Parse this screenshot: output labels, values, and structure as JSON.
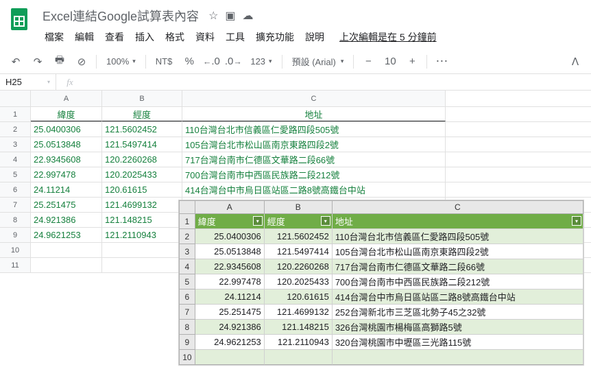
{
  "header": {
    "title": "Excel連結Google試算表內容"
  },
  "menu": {
    "file": "檔案",
    "edit": "編輯",
    "view": "查看",
    "insert": "插入",
    "format": "格式",
    "data": "資料",
    "tools": "工具",
    "ext": "擴充功能",
    "help": "說明",
    "last_edit": "上次編輯是在 5 分鐘前"
  },
  "toolbar": {
    "zoom": "100%",
    "currency": "NT$",
    "percent": "%",
    "dec0": ".0",
    "dec00": ".00",
    "numfmt": "123",
    "font": "預設 (Arial)",
    "size": "10"
  },
  "namebox": "H25",
  "sheet": {
    "cols": [
      "A",
      "B",
      "C"
    ],
    "header": {
      "lat": "緯度",
      "lng": "經度",
      "addr": "地址"
    },
    "rows": [
      {
        "lat": "25.0400306",
        "lng": "121.5602452",
        "addr": "110台灣台北市信義區仁愛路四段505號"
      },
      {
        "lat": "25.0513848",
        "lng": "121.5497414",
        "addr": "105台灣台北市松山區南京東路四段2號"
      },
      {
        "lat": "22.9345608",
        "lng": "120.2260268",
        "addr": "717台灣台南市仁德區文華路二段66號"
      },
      {
        "lat": "22.997478",
        "lng": "120.2025433",
        "addr": "700台灣台南市中西區民族路二段212號"
      },
      {
        "lat": "24.11214",
        "lng": "120.61615",
        "addr": "414台灣台中市烏日區站區二路8號高鐵台中站"
      },
      {
        "lat": "25.251475",
        "lng": "121.4699132",
        "addr": ""
      },
      {
        "lat": "24.921386",
        "lng": "121.148215",
        "addr": ""
      },
      {
        "lat": "24.9621253",
        "lng": "121.2110943",
        "addr": ""
      }
    ]
  },
  "overlay": {
    "cols": [
      "A",
      "B",
      "C"
    ],
    "header": {
      "lat": "緯度",
      "lng": "經度",
      "addr": "地址"
    },
    "rows": [
      {
        "lat": "25.0400306",
        "lng": "121.5602452",
        "addr": "110台灣台北市信義區仁愛路四段505號"
      },
      {
        "lat": "25.0513848",
        "lng": "121.5497414",
        "addr": "105台灣台北市松山區南京東路四段2號"
      },
      {
        "lat": "22.9345608",
        "lng": "120.2260268",
        "addr": "717台灣台南市仁德區文華路二段66號"
      },
      {
        "lat": "22.997478",
        "lng": "120.2025433",
        "addr": "700台灣台南市中西區民族路二段212號"
      },
      {
        "lat": "24.11214",
        "lng": "120.61615",
        "addr": "414台灣台中市烏日區站區二路8號高鐵台中站"
      },
      {
        "lat": "25.251475",
        "lng": "121.4699132",
        "addr": "252台灣新北市三芝區北勢子45之32號"
      },
      {
        "lat": "24.921386",
        "lng": "121.148215",
        "addr": "326台灣桃園市楊梅區高獅路5號"
      },
      {
        "lat": "24.9621253",
        "lng": "121.2110943",
        "addr": "320台灣桃園市中壢區三光路115號"
      }
    ]
  }
}
